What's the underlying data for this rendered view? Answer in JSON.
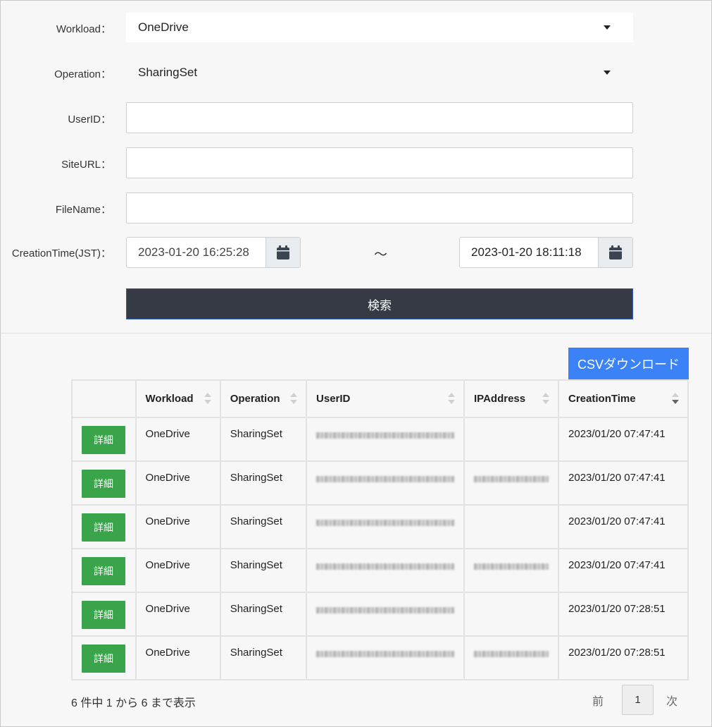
{
  "form": {
    "workload": {
      "label": "Workload：",
      "value": "OneDrive"
    },
    "operation": {
      "label": "Operation：",
      "value": "SharingSet"
    },
    "userid": {
      "label": "UserID：",
      "value": ""
    },
    "siteurl": {
      "label": "SiteURL：",
      "value": ""
    },
    "filename": {
      "label": "FileName：",
      "value": ""
    },
    "creation_time": {
      "label": "CreationTime(JST)：",
      "from": "2023-01-20 16:25:28",
      "separator": "～",
      "to": "2023-01-20 18:11:18"
    },
    "search_label": "検索"
  },
  "results": {
    "csv_label": "CSVダウンロード",
    "columns": [
      "",
      "Workload",
      "Operation",
      "UserID",
      "IPAddress",
      "CreationTime"
    ],
    "detail_label": "詳細",
    "rows": [
      {
        "workload": "OneDrive",
        "operation": "SharingSet",
        "has_ip": false,
        "creation_time": "2023/01/20 07:47:41"
      },
      {
        "workload": "OneDrive",
        "operation": "SharingSet",
        "has_ip": true,
        "creation_time": "2023/01/20 07:47:41"
      },
      {
        "workload": "OneDrive",
        "operation": "SharingSet",
        "has_ip": false,
        "creation_time": "2023/01/20 07:47:41"
      },
      {
        "workload": "OneDrive",
        "operation": "SharingSet",
        "has_ip": true,
        "creation_time": "2023/01/20 07:47:41"
      },
      {
        "workload": "OneDrive",
        "operation": "SharingSet",
        "has_ip": false,
        "creation_time": "2023/01/20 07:28:51"
      },
      {
        "workload": "OneDrive",
        "operation": "SharingSet",
        "has_ip": true,
        "creation_time": "2023/01/20 07:28:51"
      }
    ],
    "summary": "6 件中 1 から 6 まで表示",
    "pagination": {
      "prev": "前",
      "current": "1",
      "next": "次"
    }
  }
}
